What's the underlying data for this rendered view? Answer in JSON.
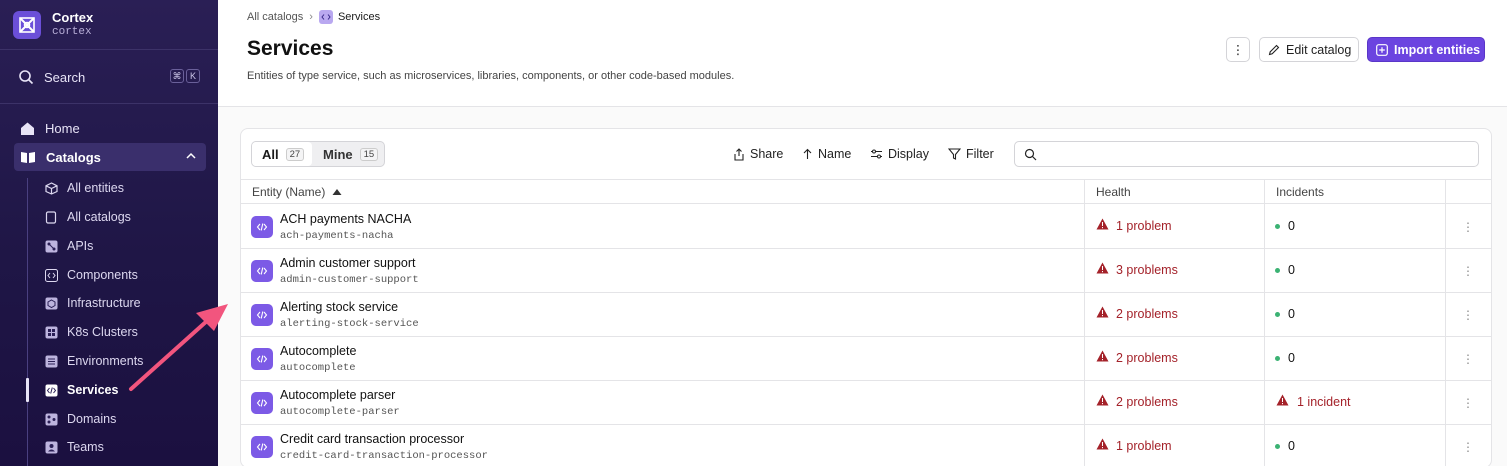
{
  "org": {
    "name": "Cortex",
    "slug": "cortex"
  },
  "sidebar": {
    "search": {
      "label": "Search",
      "shortcut": [
        "⌘",
        "K"
      ]
    },
    "home": "Home",
    "catalogs": "Catalogs",
    "items": [
      {
        "label": "All entities",
        "icon": "cube-icon"
      },
      {
        "label": "All catalogs",
        "icon": "book-icon"
      },
      {
        "label": "APIs",
        "icon": "api-icon"
      },
      {
        "label": "Components",
        "icon": "component-icon"
      },
      {
        "label": "Infrastructure",
        "icon": "infrastructure-icon"
      },
      {
        "label": "K8s Clusters",
        "icon": "k8s-icon"
      },
      {
        "label": "Environments",
        "icon": "environment-icon"
      },
      {
        "label": "Services",
        "icon": "code-icon",
        "active": true
      },
      {
        "label": "Domains",
        "icon": "domains-icon"
      },
      {
        "label": "Teams",
        "icon": "teams-icon"
      }
    ]
  },
  "breadcrumb": {
    "parent": "All catalogs",
    "current": "Services"
  },
  "header": {
    "title": "Services",
    "description": "Entities of type service, such as microservices, libraries, components, or other code-based modules.",
    "more": "⋮",
    "edit_label": "Edit catalog",
    "import_label": "Import entities"
  },
  "toolbar": {
    "tabs": [
      {
        "label": "All",
        "count": "27"
      },
      {
        "label": "Mine",
        "count": "15"
      }
    ],
    "share": "Share",
    "sort": "Name",
    "display": "Display",
    "filter": "Filter",
    "search_placeholder": ""
  },
  "table": {
    "columns": {
      "entity": "Entity (Name)",
      "health": "Health",
      "incidents": "Incidents"
    },
    "rows": [
      {
        "name": "ACH payments NACHA",
        "tag": "ach-payments-nacha",
        "health": "1 problem",
        "incidents": "0",
        "incident_alert": false
      },
      {
        "name": "Admin customer support",
        "tag": "admin-customer-support",
        "health": "3 problems",
        "incidents": "0",
        "incident_alert": false
      },
      {
        "name": "Alerting stock service",
        "tag": "alerting-stock-service",
        "health": "2 problems",
        "incidents": "0",
        "incident_alert": false
      },
      {
        "name": "Autocomplete",
        "tag": "autocomplete",
        "health": "2 problems",
        "incidents": "0",
        "incident_alert": false
      },
      {
        "name": "Autocomplete parser",
        "tag": "autocomplete-parser",
        "health": "2 problems",
        "incidents": "1 incident",
        "incident_alert": true
      },
      {
        "name": "Credit card transaction processor",
        "tag": "credit-card-transaction-processor",
        "health": "1 problem",
        "incidents": "0",
        "incident_alert": false
      }
    ]
  },
  "colors": {
    "accent": "#6b44e0",
    "sidebar": "#1f1646",
    "problem": "#a4222a",
    "ok": "#3bb273",
    "annotation_arrow": "#f2557e"
  }
}
